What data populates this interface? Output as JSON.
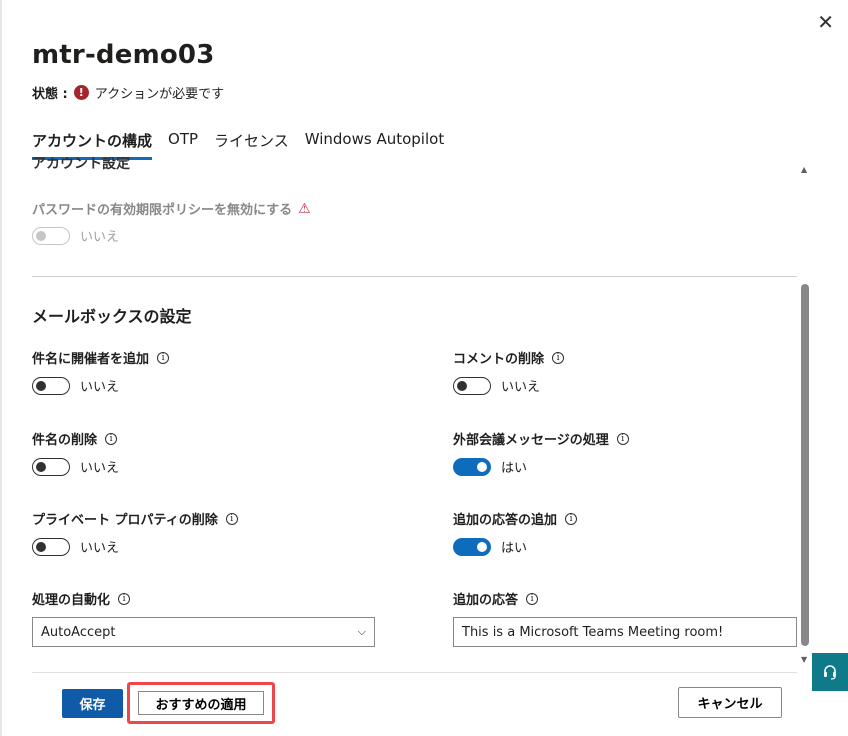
{
  "window": {
    "close_label": "✕"
  },
  "header": {
    "title": "mtr-demo03",
    "status_label": "状態 :",
    "status_icon": "error-icon",
    "status_text": "アクションが必要です"
  },
  "tabs": [
    {
      "label": "アカウントの構成",
      "active": true
    },
    {
      "label": "OTP"
    },
    {
      "label": "ライセンス"
    },
    {
      "label": "Windows Autopilot"
    }
  ],
  "account_section": {
    "title": "アカウント設定",
    "password_policy_label": "パスワードの有効期限ポリシーを無効にする",
    "password_policy_value": "いいえ"
  },
  "mailbox_section": {
    "title": "メールボックスの設定",
    "fields": {
      "add_organizer": {
        "label": "件名に開催者を追加",
        "value": "いいえ",
        "on": false
      },
      "delete_comments": {
        "label": "コメントの削除",
        "value": "いいえ",
        "on": false
      },
      "delete_subject": {
        "label": "件名の削除",
        "value": "いいえ",
        "on": false
      },
      "process_external": {
        "label": "外部会議メッセージの処理",
        "value": "はい",
        "on": true
      },
      "delete_private": {
        "label": "プライベート プロパティの削除",
        "value": "いいえ",
        "on": false
      },
      "add_response": {
        "label": "追加の応答の追加",
        "value": "はい",
        "on": true
      },
      "automate_processing": {
        "label": "処理の自動化",
        "value": "AutoAccept"
      },
      "additional_response": {
        "label": "追加の応答",
        "value": "This is a Microsoft Teams Meeting room!"
      }
    }
  },
  "footer": {
    "save_label": "保存",
    "recommend_label": "おすすめの適用",
    "cancel_label": "キャンセル"
  },
  "colors": {
    "accent": "#0f6cbd",
    "error": "#a4262c",
    "highlight": "#f0454a"
  }
}
